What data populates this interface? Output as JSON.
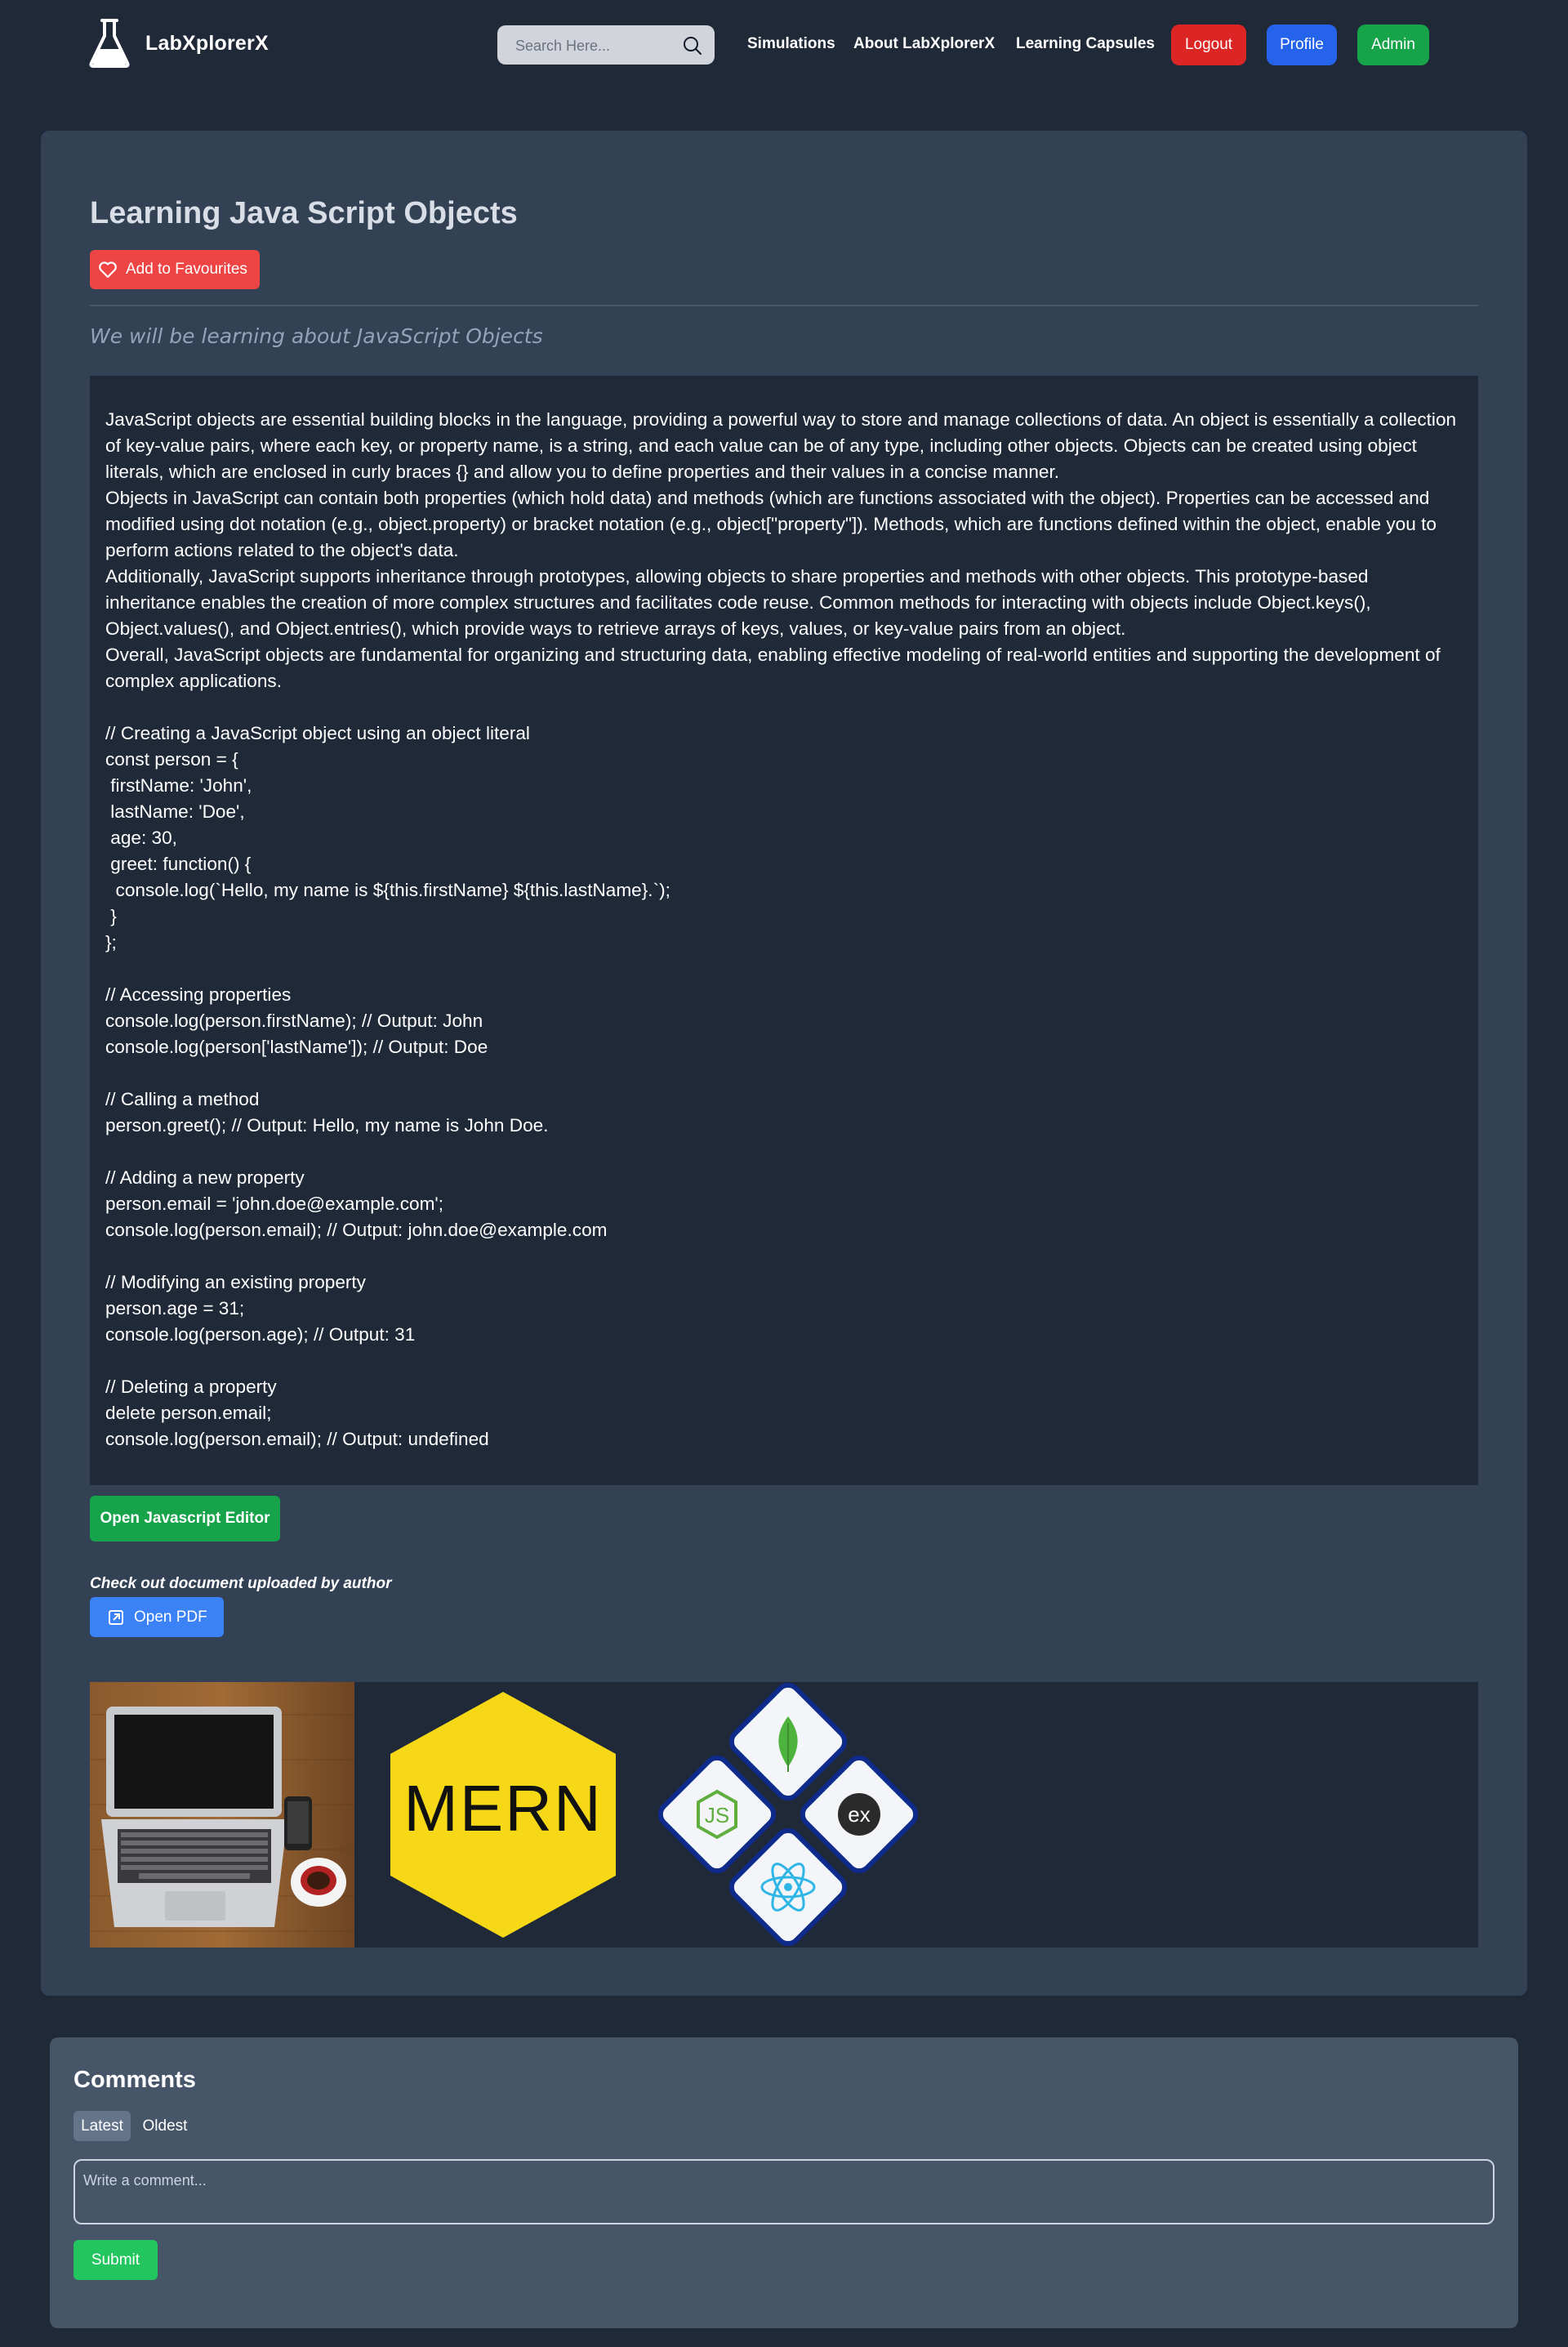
{
  "nav": {
    "brand": "LabXplorerX",
    "search_placeholder": "Search Here...",
    "links": [
      "Simulations",
      "About LabXplorerX",
      "Learning Capsules"
    ],
    "buttons": {
      "logout": "Logout",
      "profile": "Profile",
      "admin": "Admin"
    }
  },
  "capsule": {
    "title": "Learning Java Script Objects",
    "favourite_label": "Add to Favourites",
    "subtitle": "We will be learning about JavaScript Objects",
    "paragraphs": [
      "JavaScript objects are essential building blocks in the language, providing a powerful way to store and manage collections of data. An object is essentially a collection of key-value pairs, where each key, or property name, is a string, and each value can be of any type, including other objects. Objects can be created using object literals, which are enclosed in curly braces {} and allow you to define properties and their values in a concise manner.",
      "Objects in JavaScript can contain both properties (which hold data) and methods (which are functions associated with the object). Properties can be accessed and modified using dot notation (e.g., object.property) or bracket notation (e.g., object[\"property\"]). Methods, which are functions defined within the object, enable you to perform actions related to the object's data.",
      "Additionally, JavaScript supports inheritance through prototypes, allowing objects to share properties and methods with other objects. This prototype-based inheritance enables the creation of more complex structures and facilitates code reuse. Common methods for interacting with objects include Object.keys(), Object.values(), and Object.entries(), which provide ways to retrieve arrays of keys, values, or key-value pairs from an object.",
      "Overall, JavaScript objects are fundamental for organizing and structuring data, enabling effective modeling of real-world entities and supporting the development of complex applications."
    ],
    "code": "// Creating a JavaScript object using an object literal\nconst person = {\n firstName: 'John',\n lastName: 'Doe',\n age: 30,\n greet: function() {\n  console.log(`Hello, my name is ${this.firstName} ${this.lastName}.`);\n }\n};\n\n// Accessing properties\nconsole.log(person.firstName); // Output: John\nconsole.log(person['lastName']); // Output: Doe\n\n// Calling a method\nperson.greet(); // Output: Hello, my name is John Doe.\n\n// Adding a new property\nperson.email = 'john.doe@example.com';\nconsole.log(person.email); // Output: john.doe@example.com\n\n// Modifying an existing property\nperson.age = 31;\nconsole.log(person.age); // Output: 31\n\n// Deleting a property\ndelete person.email;\nconsole.log(person.email); // Output: undefined",
    "editor_button": "Open Javascript Editor",
    "pdf_label": "Check out document uploaded by author",
    "pdf_button": "Open PDF",
    "gallery_images": [
      "laptop-photo",
      "mern-hexagon-logo",
      "mern-stack-diamond-logo"
    ],
    "mern_text": "MERN",
    "ex_text": "ex",
    "js_text": "JS"
  },
  "comments": {
    "title": "Comments",
    "tabs": [
      "Latest",
      "Oldest"
    ],
    "input_placeholder": "Write a comment...",
    "submit_label": "Submit"
  },
  "colors": {
    "page_bg": "#1f2937",
    "card_bg": "#334155",
    "comments_bg": "#475569",
    "logout": "#dc2626",
    "profile": "#2563eb",
    "admin": "#16a34a",
    "favourite": "#ef4444",
    "pdf": "#3b82f6",
    "submit": "#22c55e"
  }
}
